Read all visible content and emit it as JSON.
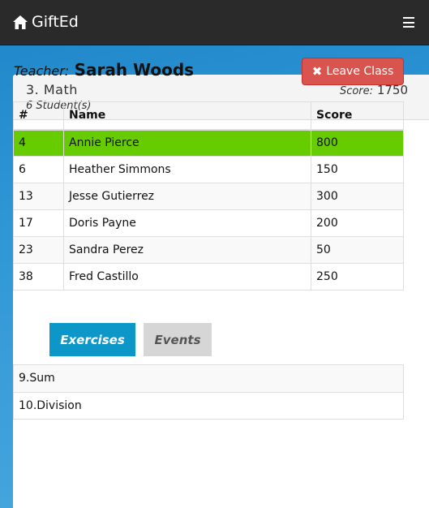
{
  "navbar": {
    "brand": "GiftEd",
    "brand_icon": "home-icon",
    "menu_icon": "hamburger-menu-icon"
  },
  "class_panel": {
    "title": "3. Math",
    "student_count": "6 Student(s)",
    "score_label": "Score:",
    "score_value": "1750",
    "teacher_label": "Teacher:",
    "teacher_name": "Sarah Woods",
    "leave_button_label": "Leave Class",
    "leave_button_icon": "close-icon",
    "leave_button_color": "#d9534f"
  },
  "students_table": {
    "headers": [
      "#",
      "Name",
      "Score"
    ],
    "highlight_color": "#66cc00",
    "rows": [
      {
        "num": "4",
        "name": "Annie Pierce",
        "score": "800",
        "highlighted": true
      },
      {
        "num": "6",
        "name": "Heather Simmons",
        "score": "150",
        "highlighted": false
      },
      {
        "num": "13",
        "name": "Jesse Gutierrez",
        "score": "300",
        "highlighted": false
      },
      {
        "num": "17",
        "name": "Doris Payne",
        "score": "200",
        "highlighted": false
      },
      {
        "num": "23",
        "name": "Sandra Perez",
        "score": "50",
        "highlighted": false
      },
      {
        "num": "38",
        "name": "Fred Castillo",
        "score": "250",
        "highlighted": false
      }
    ]
  },
  "tabs": [
    {
      "label": "Exercises",
      "active": true
    },
    {
      "label": "Events",
      "active": false
    }
  ],
  "exercises": [
    {
      "label": "9.Sum"
    },
    {
      "label": "10.Division"
    }
  ]
}
